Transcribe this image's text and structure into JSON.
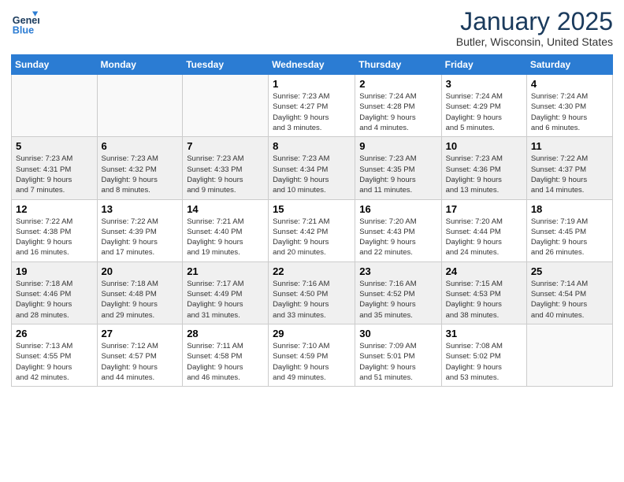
{
  "logo": {
    "line1": "General",
    "line2": "Blue"
  },
  "title": "January 2025",
  "location": "Butler, Wisconsin, United States",
  "days_of_week": [
    "Sunday",
    "Monday",
    "Tuesday",
    "Wednesday",
    "Thursday",
    "Friday",
    "Saturday"
  ],
  "weeks": [
    [
      {
        "day": "",
        "info": ""
      },
      {
        "day": "",
        "info": ""
      },
      {
        "day": "",
        "info": ""
      },
      {
        "day": "1",
        "info": "Sunrise: 7:23 AM\nSunset: 4:27 PM\nDaylight: 9 hours\nand 3 minutes."
      },
      {
        "day": "2",
        "info": "Sunrise: 7:24 AM\nSunset: 4:28 PM\nDaylight: 9 hours\nand 4 minutes."
      },
      {
        "day": "3",
        "info": "Sunrise: 7:24 AM\nSunset: 4:29 PM\nDaylight: 9 hours\nand 5 minutes."
      },
      {
        "day": "4",
        "info": "Sunrise: 7:24 AM\nSunset: 4:30 PM\nDaylight: 9 hours\nand 6 minutes."
      }
    ],
    [
      {
        "day": "5",
        "info": "Sunrise: 7:23 AM\nSunset: 4:31 PM\nDaylight: 9 hours\nand 7 minutes."
      },
      {
        "day": "6",
        "info": "Sunrise: 7:23 AM\nSunset: 4:32 PM\nDaylight: 9 hours\nand 8 minutes."
      },
      {
        "day": "7",
        "info": "Sunrise: 7:23 AM\nSunset: 4:33 PM\nDaylight: 9 hours\nand 9 minutes."
      },
      {
        "day": "8",
        "info": "Sunrise: 7:23 AM\nSunset: 4:34 PM\nDaylight: 9 hours\nand 10 minutes."
      },
      {
        "day": "9",
        "info": "Sunrise: 7:23 AM\nSunset: 4:35 PM\nDaylight: 9 hours\nand 11 minutes."
      },
      {
        "day": "10",
        "info": "Sunrise: 7:23 AM\nSunset: 4:36 PM\nDaylight: 9 hours\nand 13 minutes."
      },
      {
        "day": "11",
        "info": "Sunrise: 7:22 AM\nSunset: 4:37 PM\nDaylight: 9 hours\nand 14 minutes."
      }
    ],
    [
      {
        "day": "12",
        "info": "Sunrise: 7:22 AM\nSunset: 4:38 PM\nDaylight: 9 hours\nand 16 minutes."
      },
      {
        "day": "13",
        "info": "Sunrise: 7:22 AM\nSunset: 4:39 PM\nDaylight: 9 hours\nand 17 minutes."
      },
      {
        "day": "14",
        "info": "Sunrise: 7:21 AM\nSunset: 4:40 PM\nDaylight: 9 hours\nand 19 minutes."
      },
      {
        "day": "15",
        "info": "Sunrise: 7:21 AM\nSunset: 4:42 PM\nDaylight: 9 hours\nand 20 minutes."
      },
      {
        "day": "16",
        "info": "Sunrise: 7:20 AM\nSunset: 4:43 PM\nDaylight: 9 hours\nand 22 minutes."
      },
      {
        "day": "17",
        "info": "Sunrise: 7:20 AM\nSunset: 4:44 PM\nDaylight: 9 hours\nand 24 minutes."
      },
      {
        "day": "18",
        "info": "Sunrise: 7:19 AM\nSunset: 4:45 PM\nDaylight: 9 hours\nand 26 minutes."
      }
    ],
    [
      {
        "day": "19",
        "info": "Sunrise: 7:18 AM\nSunset: 4:46 PM\nDaylight: 9 hours\nand 28 minutes."
      },
      {
        "day": "20",
        "info": "Sunrise: 7:18 AM\nSunset: 4:48 PM\nDaylight: 9 hours\nand 29 minutes."
      },
      {
        "day": "21",
        "info": "Sunrise: 7:17 AM\nSunset: 4:49 PM\nDaylight: 9 hours\nand 31 minutes."
      },
      {
        "day": "22",
        "info": "Sunrise: 7:16 AM\nSunset: 4:50 PM\nDaylight: 9 hours\nand 33 minutes."
      },
      {
        "day": "23",
        "info": "Sunrise: 7:16 AM\nSunset: 4:52 PM\nDaylight: 9 hours\nand 35 minutes."
      },
      {
        "day": "24",
        "info": "Sunrise: 7:15 AM\nSunset: 4:53 PM\nDaylight: 9 hours\nand 38 minutes."
      },
      {
        "day": "25",
        "info": "Sunrise: 7:14 AM\nSunset: 4:54 PM\nDaylight: 9 hours\nand 40 minutes."
      }
    ],
    [
      {
        "day": "26",
        "info": "Sunrise: 7:13 AM\nSunset: 4:55 PM\nDaylight: 9 hours\nand 42 minutes."
      },
      {
        "day": "27",
        "info": "Sunrise: 7:12 AM\nSunset: 4:57 PM\nDaylight: 9 hours\nand 44 minutes."
      },
      {
        "day": "28",
        "info": "Sunrise: 7:11 AM\nSunset: 4:58 PM\nDaylight: 9 hours\nand 46 minutes."
      },
      {
        "day": "29",
        "info": "Sunrise: 7:10 AM\nSunset: 4:59 PM\nDaylight: 9 hours\nand 49 minutes."
      },
      {
        "day": "30",
        "info": "Sunrise: 7:09 AM\nSunset: 5:01 PM\nDaylight: 9 hours\nand 51 minutes."
      },
      {
        "day": "31",
        "info": "Sunrise: 7:08 AM\nSunset: 5:02 PM\nDaylight: 9 hours\nand 53 minutes."
      },
      {
        "day": "",
        "info": ""
      }
    ]
  ]
}
